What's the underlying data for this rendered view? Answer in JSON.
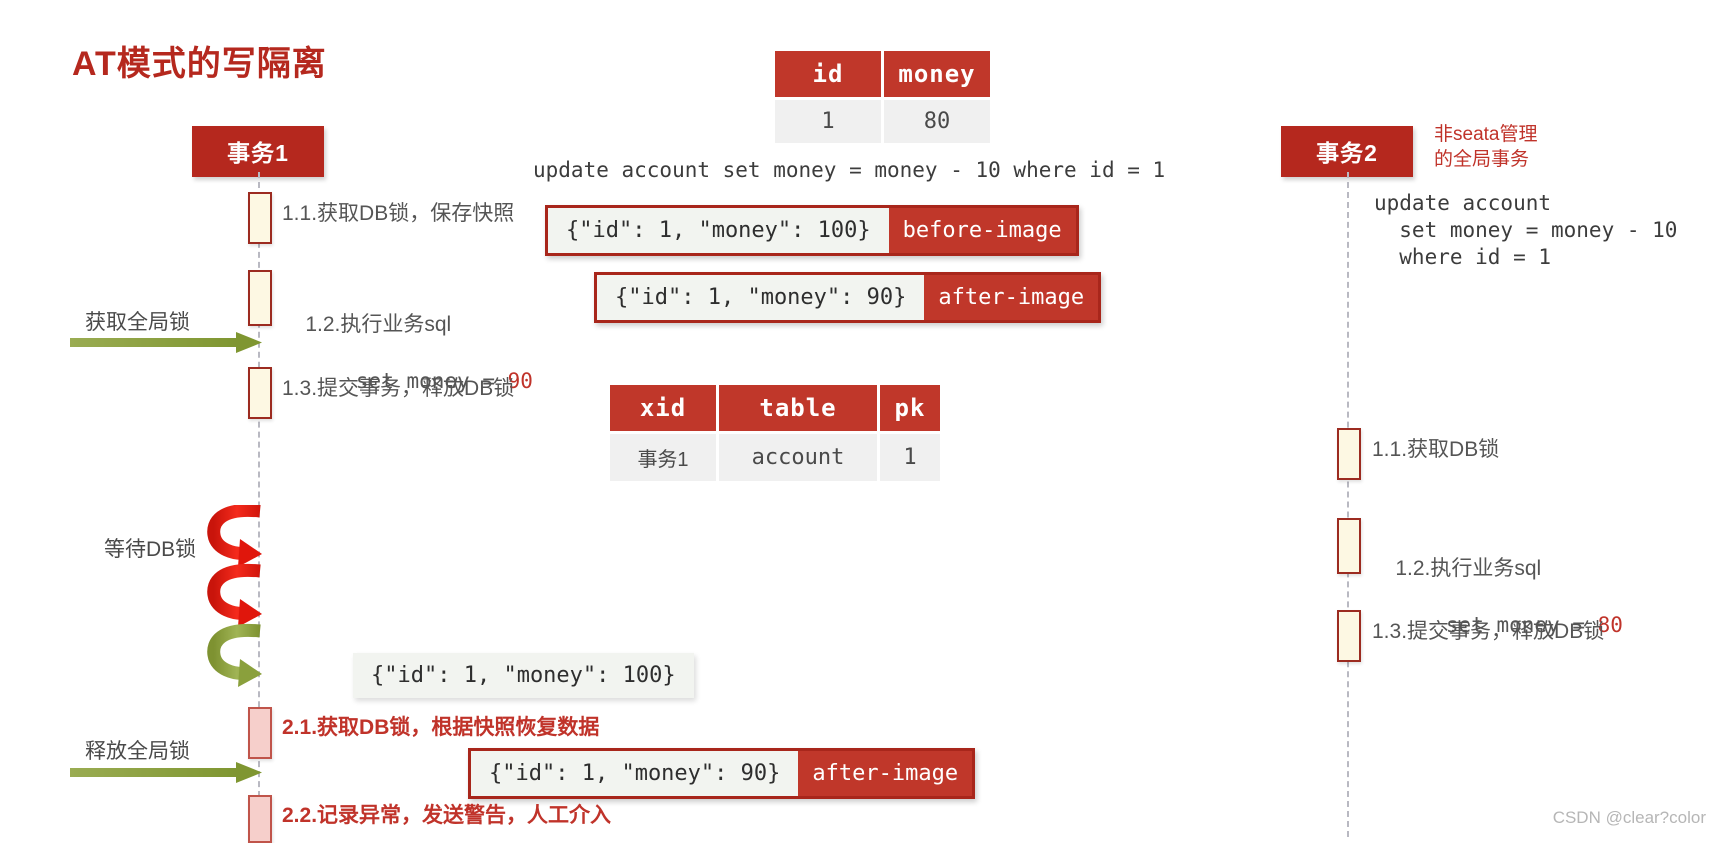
{
  "page": {
    "title": "AT模式的写隔离",
    "watermark": "CSDN @clear?color"
  },
  "colors": {
    "brand_red": "#b5281e",
    "table_header_red": "#c0372a",
    "activation_fill": "#fdf8e3",
    "activation_rollback_fill": "#f6cfcb",
    "arrow_green": "#8aa03c",
    "spiral_red": "#e8241a",
    "lifeline_gray": "#b9b9c2"
  },
  "account_table": {
    "name": "account-table",
    "headers": [
      "id",
      "money"
    ],
    "rows": [
      [
        "1",
        "80"
      ]
    ]
  },
  "lock_table": {
    "name": "global-lock-table",
    "headers": [
      "xid",
      "table",
      "pk"
    ],
    "rows": [
      [
        "事务1",
        "account",
        "1"
      ]
    ]
  },
  "transaction1": {
    "box_label": "事务1",
    "sql": "update account set money = money - 10 where id = 1",
    "steps": [
      {
        "label": "1.1.获取DB锁，保存快照"
      },
      {
        "label": "1.2.执行业务sql",
        "sub_prefix": "    set money = ",
        "sub_value": "90"
      },
      {
        "label": "1.3.提交事务，释放DB锁"
      },
      {
        "label": "2.1.获取DB锁，根据快照恢复数据"
      },
      {
        "label": "2.2.记录异常，发送警告，人工介入"
      }
    ],
    "before_image": {
      "json": "{\"id\": 1, \"money\": 100}",
      "tag": "before-image"
    },
    "after_image": {
      "json": "{\"id\": 1, \"money\": 90}",
      "tag": "after-image"
    },
    "restore_snapshot": {
      "json": "{\"id\": 1, \"money\": 100}"
    },
    "rollback_after_image": {
      "json": "{\"id\": 1, \"money\": 90}",
      "tag": "after-image"
    }
  },
  "transaction2": {
    "box_label": "事务2",
    "note": "非seata管理\n的全局事务",
    "sql": "update account\n  set money = money - 10\n  where id = 1",
    "steps": [
      {
        "label": "1.1.获取DB锁"
      },
      {
        "label": "1.2.执行业务sql",
        "sub_prefix": "    set money = ",
        "sub_value": "80"
      },
      {
        "label": "1.3.提交事务，释放DB锁"
      }
    ]
  },
  "annotations": {
    "acquire_global_lock": "获取全局锁",
    "wait_db_lock": "等待DB锁",
    "release_global_lock": "释放全局锁"
  }
}
